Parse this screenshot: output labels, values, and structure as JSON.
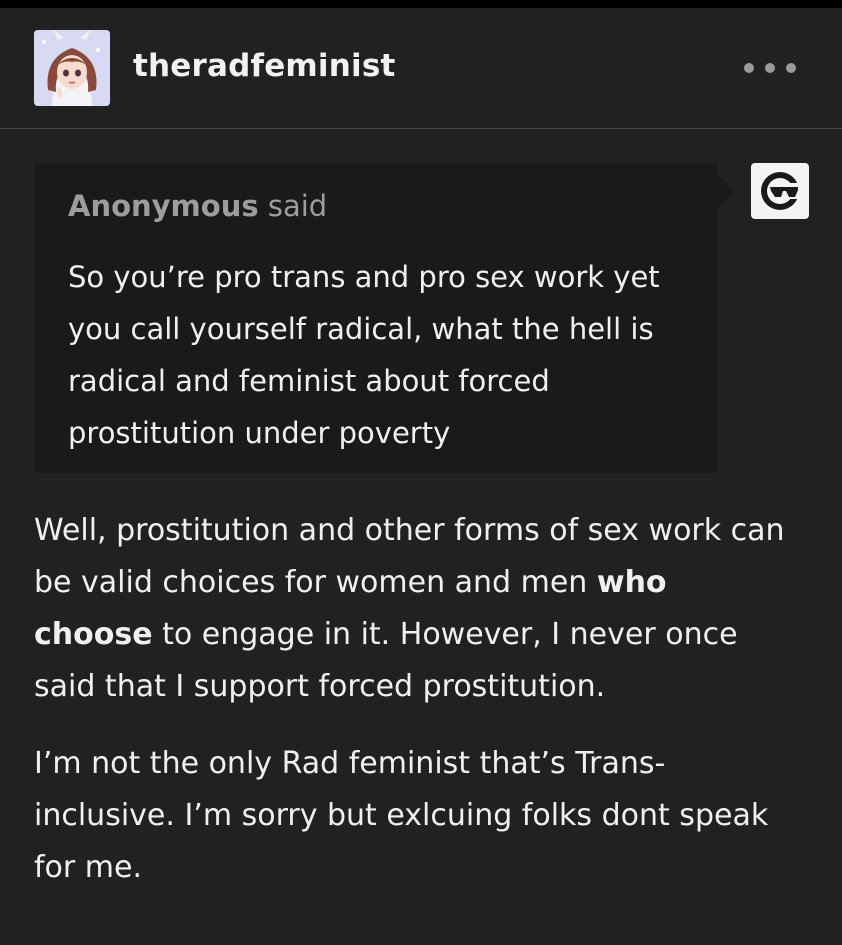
{
  "post": {
    "username": "theradfeminist",
    "ask": {
      "asker_name": "Anonymous",
      "asker_suffix": "said",
      "question": "So you’re pro trans and pro sex work yet you call yourself radical, what the hell is radical and feminist about forced prostitution under poverty"
    },
    "answer": {
      "p1_before": "Well, prostitution and other forms of sex work can be valid choices for women and men ",
      "p1_bold": "who choose",
      "p1_after": " to engage in it. However, I never once said that I support forced prostitution.",
      "p2": "I’m not the only Rad feminist that’s Trans-inclusive. I’m sorry but exlcuing folks dont speak for me."
    }
  },
  "icons": {
    "avatar": "anime-girl-avatar",
    "more": "more-dots-icon",
    "anonymous": "sunglasses-face-icon"
  }
}
